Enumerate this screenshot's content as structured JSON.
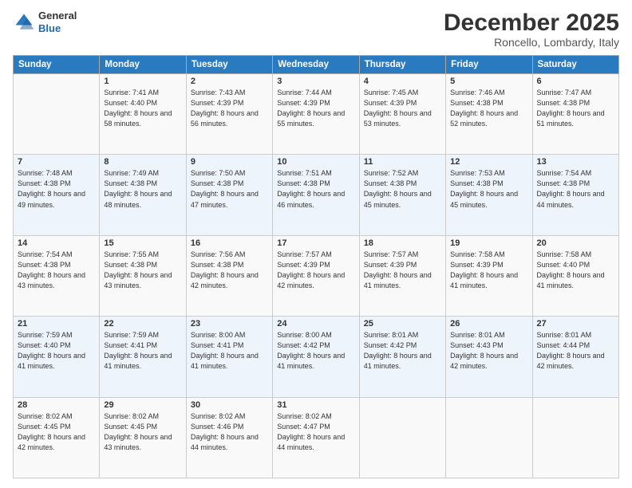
{
  "header": {
    "logo_general": "General",
    "logo_blue": "Blue",
    "month_title": "December 2025",
    "subtitle": "Roncello, Lombardy, Italy"
  },
  "weekdays": [
    "Sunday",
    "Monday",
    "Tuesday",
    "Wednesday",
    "Thursday",
    "Friday",
    "Saturday"
  ],
  "weeks": [
    [
      {
        "day": "",
        "sunrise": "",
        "sunset": "",
        "daylight": ""
      },
      {
        "day": "1",
        "sunrise": "Sunrise: 7:41 AM",
        "sunset": "Sunset: 4:40 PM",
        "daylight": "Daylight: 8 hours and 58 minutes."
      },
      {
        "day": "2",
        "sunrise": "Sunrise: 7:43 AM",
        "sunset": "Sunset: 4:39 PM",
        "daylight": "Daylight: 8 hours and 56 minutes."
      },
      {
        "day": "3",
        "sunrise": "Sunrise: 7:44 AM",
        "sunset": "Sunset: 4:39 PM",
        "daylight": "Daylight: 8 hours and 55 minutes."
      },
      {
        "day": "4",
        "sunrise": "Sunrise: 7:45 AM",
        "sunset": "Sunset: 4:39 PM",
        "daylight": "Daylight: 8 hours and 53 minutes."
      },
      {
        "day": "5",
        "sunrise": "Sunrise: 7:46 AM",
        "sunset": "Sunset: 4:38 PM",
        "daylight": "Daylight: 8 hours and 52 minutes."
      },
      {
        "day": "6",
        "sunrise": "Sunrise: 7:47 AM",
        "sunset": "Sunset: 4:38 PM",
        "daylight": "Daylight: 8 hours and 51 minutes."
      }
    ],
    [
      {
        "day": "7",
        "sunrise": "Sunrise: 7:48 AM",
        "sunset": "Sunset: 4:38 PM",
        "daylight": "Daylight: 8 hours and 49 minutes."
      },
      {
        "day": "8",
        "sunrise": "Sunrise: 7:49 AM",
        "sunset": "Sunset: 4:38 PM",
        "daylight": "Daylight: 8 hours and 48 minutes."
      },
      {
        "day": "9",
        "sunrise": "Sunrise: 7:50 AM",
        "sunset": "Sunset: 4:38 PM",
        "daylight": "Daylight: 8 hours and 47 minutes."
      },
      {
        "day": "10",
        "sunrise": "Sunrise: 7:51 AM",
        "sunset": "Sunset: 4:38 PM",
        "daylight": "Daylight: 8 hours and 46 minutes."
      },
      {
        "day": "11",
        "sunrise": "Sunrise: 7:52 AM",
        "sunset": "Sunset: 4:38 PM",
        "daylight": "Daylight: 8 hours and 45 minutes."
      },
      {
        "day": "12",
        "sunrise": "Sunrise: 7:53 AM",
        "sunset": "Sunset: 4:38 PM",
        "daylight": "Daylight: 8 hours and 45 minutes."
      },
      {
        "day": "13",
        "sunrise": "Sunrise: 7:54 AM",
        "sunset": "Sunset: 4:38 PM",
        "daylight": "Daylight: 8 hours and 44 minutes."
      }
    ],
    [
      {
        "day": "14",
        "sunrise": "Sunrise: 7:54 AM",
        "sunset": "Sunset: 4:38 PM",
        "daylight": "Daylight: 8 hours and 43 minutes."
      },
      {
        "day": "15",
        "sunrise": "Sunrise: 7:55 AM",
        "sunset": "Sunset: 4:38 PM",
        "daylight": "Daylight: 8 hours and 43 minutes."
      },
      {
        "day": "16",
        "sunrise": "Sunrise: 7:56 AM",
        "sunset": "Sunset: 4:38 PM",
        "daylight": "Daylight: 8 hours and 42 minutes."
      },
      {
        "day": "17",
        "sunrise": "Sunrise: 7:57 AM",
        "sunset": "Sunset: 4:39 PM",
        "daylight": "Daylight: 8 hours and 42 minutes."
      },
      {
        "day": "18",
        "sunrise": "Sunrise: 7:57 AM",
        "sunset": "Sunset: 4:39 PM",
        "daylight": "Daylight: 8 hours and 41 minutes."
      },
      {
        "day": "19",
        "sunrise": "Sunrise: 7:58 AM",
        "sunset": "Sunset: 4:39 PM",
        "daylight": "Daylight: 8 hours and 41 minutes."
      },
      {
        "day": "20",
        "sunrise": "Sunrise: 7:58 AM",
        "sunset": "Sunset: 4:40 PM",
        "daylight": "Daylight: 8 hours and 41 minutes."
      }
    ],
    [
      {
        "day": "21",
        "sunrise": "Sunrise: 7:59 AM",
        "sunset": "Sunset: 4:40 PM",
        "daylight": "Daylight: 8 hours and 41 minutes."
      },
      {
        "day": "22",
        "sunrise": "Sunrise: 7:59 AM",
        "sunset": "Sunset: 4:41 PM",
        "daylight": "Daylight: 8 hours and 41 minutes."
      },
      {
        "day": "23",
        "sunrise": "Sunrise: 8:00 AM",
        "sunset": "Sunset: 4:41 PM",
        "daylight": "Daylight: 8 hours and 41 minutes."
      },
      {
        "day": "24",
        "sunrise": "Sunrise: 8:00 AM",
        "sunset": "Sunset: 4:42 PM",
        "daylight": "Daylight: 8 hours and 41 minutes."
      },
      {
        "day": "25",
        "sunrise": "Sunrise: 8:01 AM",
        "sunset": "Sunset: 4:42 PM",
        "daylight": "Daylight: 8 hours and 41 minutes."
      },
      {
        "day": "26",
        "sunrise": "Sunrise: 8:01 AM",
        "sunset": "Sunset: 4:43 PM",
        "daylight": "Daylight: 8 hours and 42 minutes."
      },
      {
        "day": "27",
        "sunrise": "Sunrise: 8:01 AM",
        "sunset": "Sunset: 4:44 PM",
        "daylight": "Daylight: 8 hours and 42 minutes."
      }
    ],
    [
      {
        "day": "28",
        "sunrise": "Sunrise: 8:02 AM",
        "sunset": "Sunset: 4:45 PM",
        "daylight": "Daylight: 8 hours and 42 minutes."
      },
      {
        "day": "29",
        "sunrise": "Sunrise: 8:02 AM",
        "sunset": "Sunset: 4:45 PM",
        "daylight": "Daylight: 8 hours and 43 minutes."
      },
      {
        "day": "30",
        "sunrise": "Sunrise: 8:02 AM",
        "sunset": "Sunset: 4:46 PM",
        "daylight": "Daylight: 8 hours and 44 minutes."
      },
      {
        "day": "31",
        "sunrise": "Sunrise: 8:02 AM",
        "sunset": "Sunset: 4:47 PM",
        "daylight": "Daylight: 8 hours and 44 minutes."
      },
      {
        "day": "",
        "sunrise": "",
        "sunset": "",
        "daylight": ""
      },
      {
        "day": "",
        "sunrise": "",
        "sunset": "",
        "daylight": ""
      },
      {
        "day": "",
        "sunrise": "",
        "sunset": "",
        "daylight": ""
      }
    ]
  ]
}
